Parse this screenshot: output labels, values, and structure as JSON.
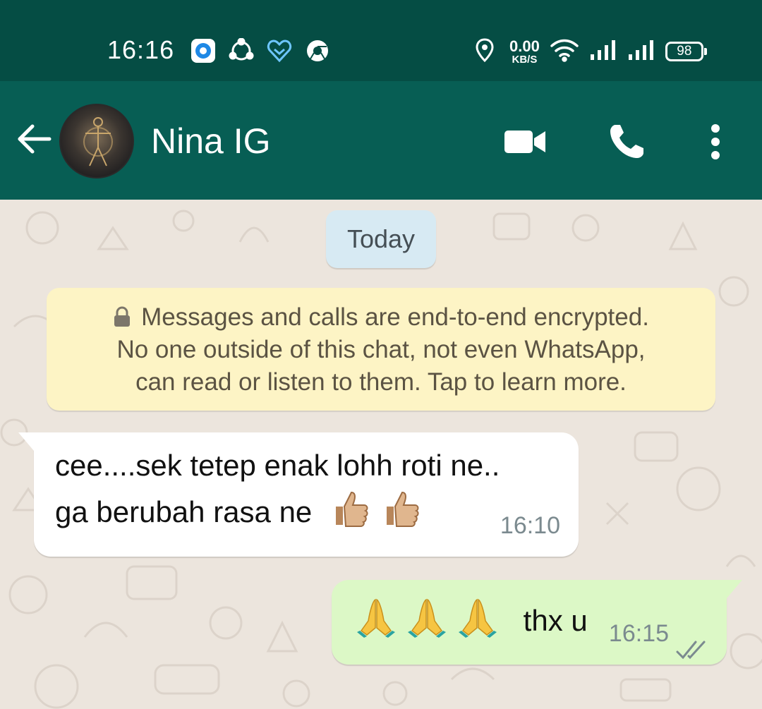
{
  "status_bar": {
    "time": "16:16",
    "network_speed_value": "0.00",
    "network_speed_unit": "KB/S",
    "battery_level": "98",
    "app_icons": [
      "notification-app-icon",
      "share-app-icon",
      "heart-app-icon",
      "chrome-icon"
    ],
    "system_icons": [
      "location-icon",
      "wifi-icon",
      "signal-sim1-icon",
      "signal-sim2-icon",
      "battery-icon"
    ]
  },
  "header": {
    "contact_name": "Nina IG",
    "back_icon": "arrow-left-icon",
    "actions": [
      "video-call-icon",
      "voice-call-icon",
      "more-vertical-icon"
    ]
  },
  "chat": {
    "date_label": "Today",
    "encryption_notice": {
      "line1": "Messages and calls are end-to-end encrypted.",
      "line2": "No one outside of this chat, not even WhatsApp,",
      "line3": "can read or listen to them. Tap to learn more."
    },
    "messages": [
      {
        "direction": "incoming",
        "line1": "cee....sek tetep enak lohh roti ne..",
        "line2": "ga berubah rasa ne",
        "emojis": [
          "thumbs-up-emoji",
          "thumbs-up-emoji"
        ],
        "time": "16:10"
      },
      {
        "direction": "outgoing",
        "emojis": [
          "folded-hands-emoji",
          "folded-hands-emoji",
          "folded-hands-emoji"
        ],
        "text": "thx u",
        "time": "16:15",
        "status": "double-check-icon"
      }
    ]
  },
  "colors": {
    "status_bar_bg": "#054d44",
    "header_bg": "#075e54",
    "chat_bg": "#ece5dd",
    "date_chip_bg": "#d7eaf3",
    "notice_bg": "#fdf4c5",
    "incoming_bubble": "#ffffff",
    "outgoing_bubble": "#dcf8c6"
  }
}
